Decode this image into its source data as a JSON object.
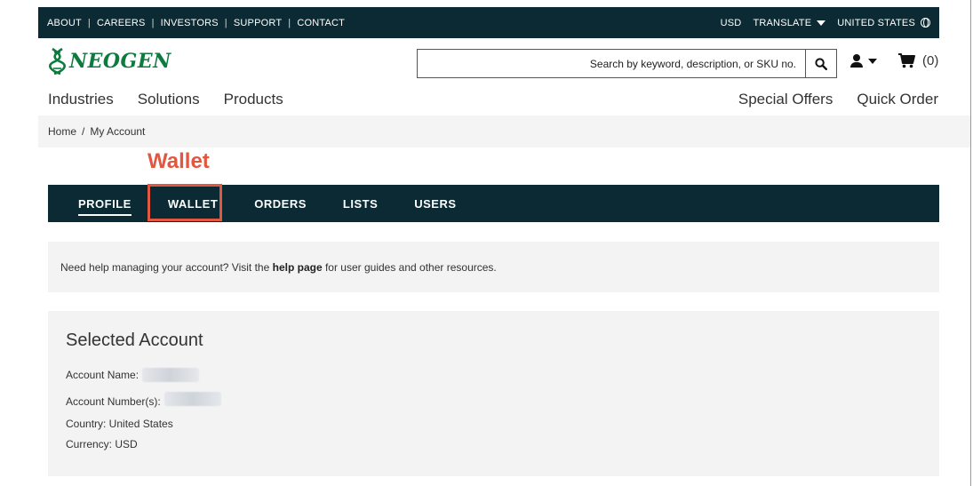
{
  "utility_bar": {
    "links": [
      "ABOUT",
      "CAREERS",
      "INVESTORS",
      "SUPPORT",
      "CONTACT"
    ],
    "currency": "USD",
    "translate": "TRANSLATE",
    "region": "UNITED STATES"
  },
  "header": {
    "logo_text": "NEOGEN",
    "search_placeholder": "Search by keyword, description, or SKU no.",
    "cart_count": "(0)"
  },
  "main_nav": {
    "items": [
      "Industries",
      "Solutions",
      "Products"
    ],
    "secondary": [
      "Special Offers",
      "Quick Order"
    ]
  },
  "breadcrumb": {
    "items": [
      "Home",
      "My Account"
    ],
    "separator": "/"
  },
  "annotation": {
    "label": "Wallet",
    "color": "#e2573f"
  },
  "account_tabs": {
    "items": [
      "PROFILE",
      "WALLET",
      "ORDERS",
      "LISTS",
      "USERS"
    ],
    "active": "PROFILE"
  },
  "help": {
    "prefix": "Need help managing your account? Visit the",
    "link": "help page",
    "suffix": "for user guides and other resources."
  },
  "account": {
    "title": "Selected Account",
    "name_label": "Account Name:",
    "number_label": "Account Number(s):",
    "country": "Country: United States",
    "currency": "Currency: USD"
  },
  "colors": {
    "dark_bar": "#0b2a33",
    "brand_green": "#0d7a3e",
    "panel": "#f3f3f3"
  }
}
